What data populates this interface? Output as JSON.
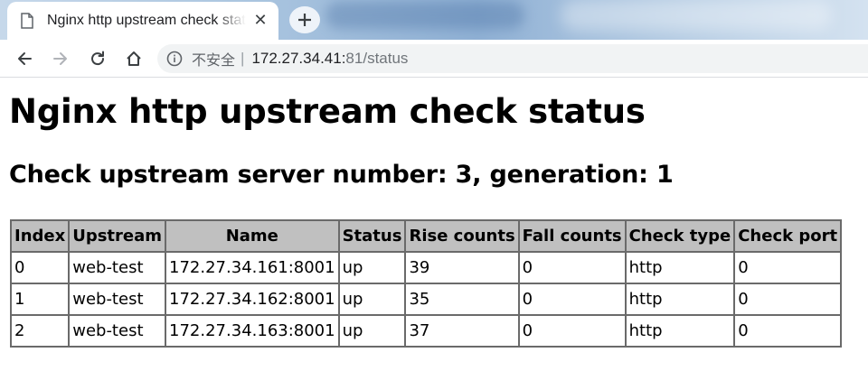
{
  "browser": {
    "tab": {
      "title": "Nginx http upstream check status",
      "close_glyph": "✕",
      "icon": "page-icon"
    },
    "new_tab_glyph": "+",
    "toolbar": {
      "back_icon": "back-arrow-icon",
      "forward_icon": "forward-arrow-icon",
      "reload_icon": "reload-icon",
      "home_icon": "home-icon"
    },
    "address": {
      "security_label": "不安全",
      "separator": "|",
      "host": "172.27.34.41:",
      "port": "81",
      "path": "/status"
    }
  },
  "page": {
    "heading": "Nginx http upstream check status",
    "subheading": "Check upstream server number: 3, generation: 1",
    "table": {
      "headers": [
        "Index",
        "Upstream",
        "Name",
        "Status",
        "Rise counts",
        "Fall counts",
        "Check type",
        "Check port"
      ],
      "rows": [
        [
          "0",
          "web-test",
          "172.27.34.161:8001",
          "up",
          "39",
          "0",
          "http",
          "0"
        ],
        [
          "1",
          "web-test",
          "172.27.34.162:8001",
          "up",
          "35",
          "0",
          "http",
          "0"
        ],
        [
          "2",
          "web-test",
          "172.27.34.163:8001",
          "up",
          "37",
          "0",
          "http",
          "0"
        ]
      ]
    }
  },
  "colors": {
    "table_header_bg": "#c0c0c0",
    "table_border": "#6a6a6a",
    "omnibox_bg": "#f1f3f4"
  }
}
